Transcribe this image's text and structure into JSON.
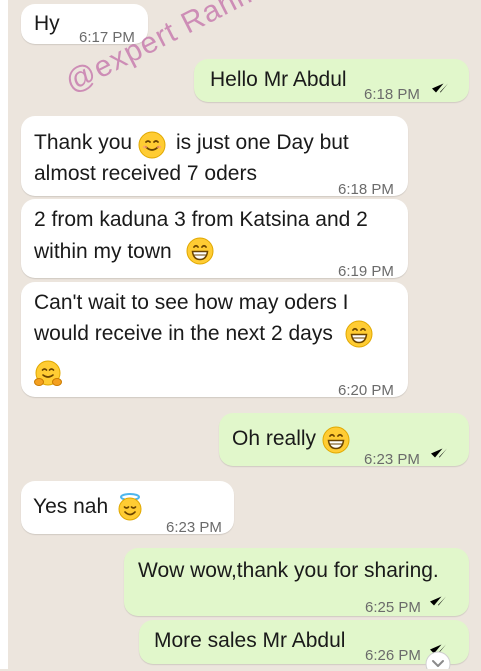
{
  "watermark": "@expert Rahma",
  "messages": [
    {
      "id": "m1",
      "dir": "in",
      "text": "Hy",
      "time": "6:17 PM"
    },
    {
      "id": "m2",
      "dir": "out",
      "text": "Hello Mr Abdul",
      "time": "6:18 PM",
      "read": true
    },
    {
      "id": "m3",
      "dir": "in",
      "line1a": "Thank you",
      "line1b": "is just one Day  but",
      "line2": "almost received 7 oders",
      "time": "6:18 PM",
      "emoji": "smiling-face-emoji"
    },
    {
      "id": "m4",
      "dir": "in",
      "line1": "2 from kaduna 3 from Katsina and 2",
      "line2": "within my town",
      "time": "6:19 PM",
      "emoji": "grinning-face-emoji"
    },
    {
      "id": "m5",
      "dir": "in",
      "line1": "Can't wait to see how may oders I",
      "line2": "would receive in the next 2 days",
      "time": "6:20 PM",
      "emoji": "grinning-face-emoji",
      "emoji2": "hugging-face-emoji"
    },
    {
      "id": "m6",
      "dir": "out",
      "text": "Oh really",
      "time": "6:23 PM",
      "read": true,
      "emoji": "grinning-face-emoji"
    },
    {
      "id": "m7",
      "dir": "in",
      "text": "Yes nah",
      "time": "6:23 PM",
      "emoji": "smiling-face-with-halo-emoji"
    },
    {
      "id": "m8",
      "dir": "out",
      "text": "Wow wow,thank you for sharing.",
      "time": "6:25 PM",
      "read": true
    },
    {
      "id": "m9",
      "dir": "out",
      "text": "More sales Mr Abdul",
      "time": "6:26 PM",
      "read": true
    }
  ],
  "colors": {
    "background": "#ece5dd",
    "incoming_bubble": "#ffffff",
    "outgoing_bubble": "#e1f7cb",
    "read_ticks": "#4fb6ec",
    "timestamp": "#6b6b6b"
  }
}
